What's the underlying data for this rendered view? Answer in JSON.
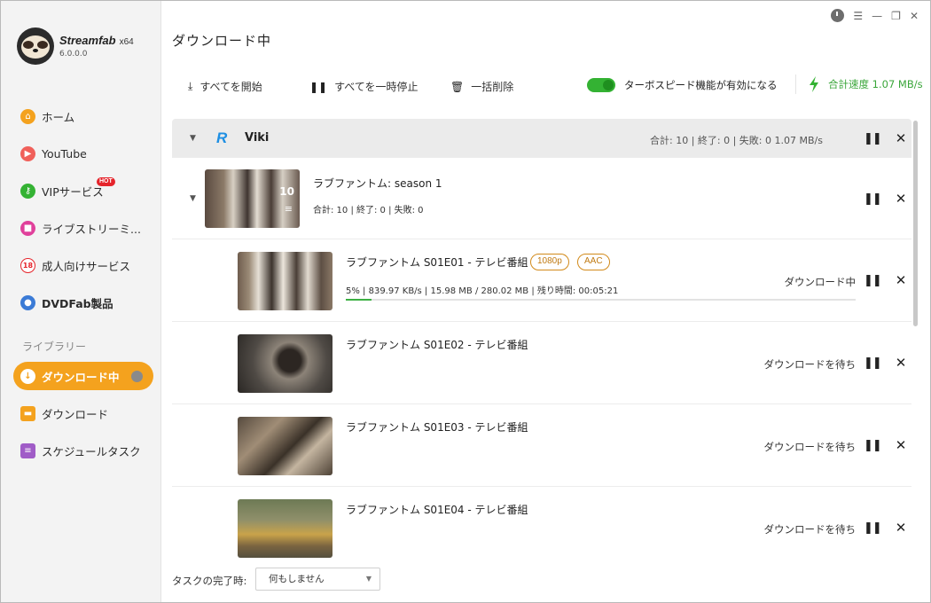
{
  "app": {
    "name": "Streamfab",
    "arch": "x64",
    "version": "6.0.0.0",
    "page_title": "ダウンロード中"
  },
  "sidebar": {
    "items": [
      {
        "label": "ホーム",
        "icon": "home-icon",
        "color": "#f4a21e"
      },
      {
        "label": "YouTube",
        "icon": "youtube-icon",
        "color": "#f0605a"
      },
      {
        "label": "VIPサービス",
        "icon": "key-icon",
        "color": "#34b233",
        "badge": "HOT"
      },
      {
        "label": "ライブストリーミ...",
        "icon": "video-camera-icon",
        "color": "#e0409b"
      },
      {
        "label": "成人向けサービス",
        "icon": "adult-18-icon",
        "color": "#e5242b"
      },
      {
        "label": "DVDFab製品",
        "icon": "dvdfab-icon",
        "color": "#3b7bd6"
      }
    ],
    "library_title": "ライブラリー",
    "library": [
      {
        "label": "ダウンロード中",
        "icon": "download-arrow-icon",
        "active": true
      },
      {
        "label": "ダウンロード",
        "icon": "folder-icon",
        "color": "#f4a21e"
      },
      {
        "label": "スケジュールタスク",
        "icon": "schedule-list-icon",
        "color": "#a05cc7"
      }
    ]
  },
  "toolbar": {
    "start_all": "すべてを開始",
    "pause_all": "すべてを一時停止",
    "delete_all": "一括削除",
    "turbo_label": "ターボスピード機能が有効になる",
    "turbo_enabled": true,
    "total_speed": "合計速度 1.07 MB/s",
    "accent": "#34b233"
  },
  "group": {
    "name": "Viki",
    "stats": "合計: 10 | 終了: 0 | 失敗: 0    1.07 MB/s",
    "season": {
      "title": "ラブファントム: season 1",
      "count": "10",
      "stats": "合計: 10 | 終了: 0 | 失敗: 0"
    },
    "episodes": [
      {
        "title": "ラブファントム S01E01 - テレビ番組",
        "badges": [
          "1080p",
          "AAC"
        ],
        "progress_text": "5% | 839.97 KB/s | 15.98 MB / 280.02 MB | 残り時間: 00:05:21",
        "progress": 0.05,
        "status": "ダウンロード中"
      },
      {
        "title": "ラブファントム S01E02 - テレビ番組",
        "status": "ダウンロードを待ち"
      },
      {
        "title": "ラブファントム S01E03 - テレビ番組",
        "status": "ダウンロードを待ち"
      },
      {
        "title": "ラブファントム S01E04 - テレビ番組",
        "status": "ダウンロードを待ち"
      }
    ]
  },
  "footer": {
    "completion_label": "タスクの完了時:",
    "completion_value": "何もしません"
  }
}
